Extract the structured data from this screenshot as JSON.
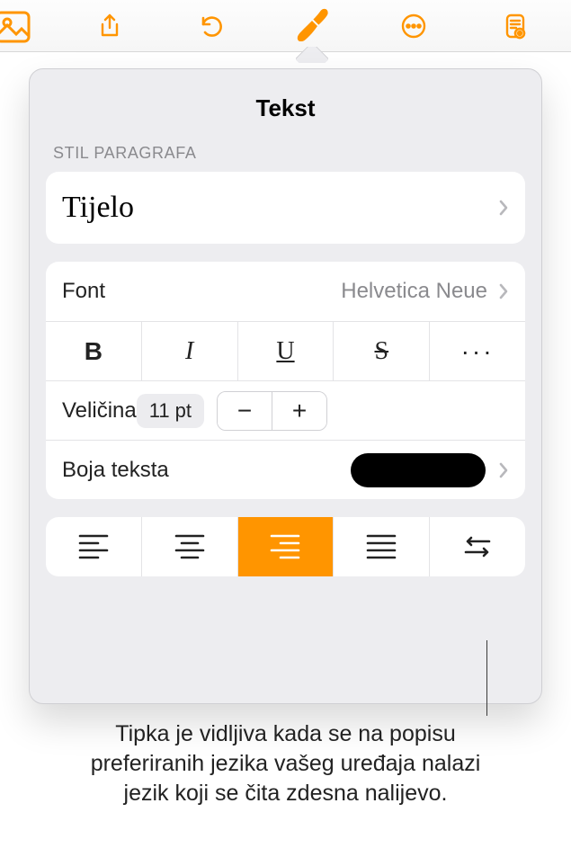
{
  "panel": {
    "title": "Tekst",
    "paragraphSectionLabel": "STIL PARAGRAFA",
    "paragraphStyleName": "Tijelo",
    "fontLabel": "Font",
    "fontValue": "Helvetica Neue",
    "styleButtons": {
      "bold": "B",
      "italic": "I",
      "underline": "U",
      "strike": "S",
      "more": "···"
    },
    "sizeLabel": "Veličina",
    "sizeValue": "11 pt",
    "stepMinus": "−",
    "stepPlus": "+",
    "colorLabel": "Boja teksta",
    "textColor": "#000000"
  },
  "caption": "Tipka je vidljiva kada se na popisu preferiranih jezika vašeg uređaja nalazi jezik koji se čita zdesna nalijevo."
}
